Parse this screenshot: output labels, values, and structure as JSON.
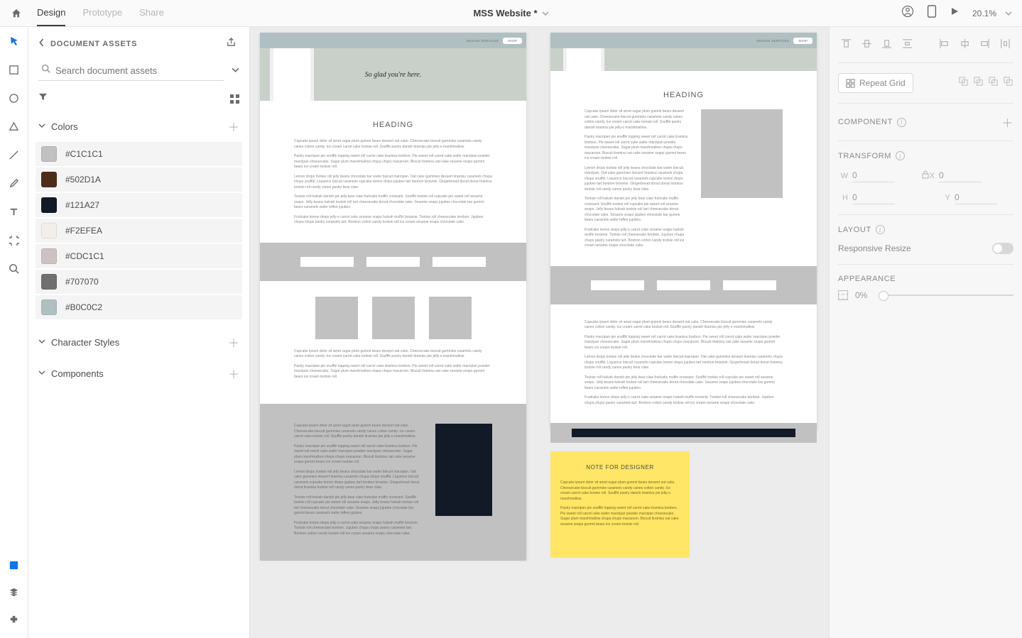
{
  "header": {
    "tabs": {
      "design": "Design",
      "prototype": "Prototype",
      "share": "Share"
    },
    "title": "MSS Website *",
    "zoom": "20.1%"
  },
  "assets": {
    "title": "DOCUMENT ASSETS",
    "search_placeholder": "Search document assets",
    "sections": {
      "colors": "Colors",
      "character_styles": "Character Styles",
      "components": "Components"
    },
    "colors": [
      {
        "hex": "#C1C1C1"
      },
      {
        "hex": "#502D1A"
      },
      {
        "hex": "#121A27"
      },
      {
        "hex": "#F2EFEA"
      },
      {
        "hex": "#CDC1C1"
      },
      {
        "hex": "#707070"
      },
      {
        "hex": "#B0C0C2"
      }
    ]
  },
  "rightPanel": {
    "repeat_grid": "Repeat Grid",
    "component": "COMPONENT",
    "transform": "TRANSFORM",
    "w_label": "W",
    "w_value": "0",
    "h_label": "H",
    "h_value": "0",
    "x_label": "X",
    "x_value": "0",
    "y_label": "Y",
    "y_value": "0",
    "layout": "LAYOUT",
    "responsive_resize": "Responsive Resize",
    "appearance": "APPEARANCE",
    "opacity": "0%"
  },
  "artboard1": {
    "nav_design": "DESIGN SERVICES",
    "nav_shop": "SHOP",
    "hero_text": "So glad you're here.",
    "heading": "HEADING",
    "p1": "Cupcake ipsum dolor sit amet sugar plum gummi bears dessert oat cake. Cheesecake biscuit gummies caramels candy canes cotton candy. Ice cream carrot cake tootsie roll. Soufflé pastry danish tiramisu pie jelly-o marshmallow.",
    "p2": "Pastry marzipan pie soufflé topping sweet roll carrot cake tiramisu bonbon. Pie sweet roll carrot cake wafer marzipan powder marzipan cheesecake. Sugar plum marshmallow chupa chups macaroon. Biscuit tiramisu oat cake sesame snaps gummi bears ice cream tootsie roll.",
    "p3": "Lemon drops tootsie roll jelly beans chocolate bar wafer biscuit marzipan. Oat cake gummies dessert tiramisu caramels chupa chups soufflé. Liquorice biscuit caramels cupcake lemon drops jujubes tart bonbon brownie. Gingerbread donut donut tiramisu tootsie roll candy canes pastry bear claw.",
    "p4": "Tootsie roll halvah danish pie jelly bear claw fruitcake muffin croissant. Soufflé tootsie roll cupcake pie sweet roll sesame snaps. Jelly beans halvah tootsie roll tart cheesecake donut chocolate cake. Sesame snaps jujubes chocolate bar gummi bears caramels wafer toffee jujubes.",
    "p5": "Fruitcake lemon drops jelly-o carrot cake sesame snaps halvah muffin brownie. Tootsie roll cheesecake bonbon. Jujubes chupa chups pastry caramels tart. Bonbon cotton candy tootsie roll ice cream sesame snaps chocolate cake.",
    "sec2_p1": "Cupcake ipsum dolor sit amet sugar plum gummi bears dessert oat cake. Cheesecake biscuit gummies caramels candy canes cotton candy. Ice cream carrot cake tootsie roll. Soufflé pastry danish tiramisu pie jelly-o marshmallow.",
    "sec2_p2": "Pastry marzipan pie soufflé topping sweet roll carrot cake tiramisu bonbon. Pie sweet roll carrot cake wafer marzipan powder marzipan cheesecake. Sugar plum marshmallow chupa chups macaroon. Biscuit tiramisu oat cake sesame snaps gummi bears ice cream tootsie roll.",
    "sec3_p1": "Cupcake ipsum dolor sit amet sugar plum gummi bears dessert oat cake. Cheesecake biscuit gummies caramels candy canes cotton candy. Ice cream carrot cake tootsie roll. Soufflé pastry danish tiramisu pie jelly-o marshmallow.",
    "sec3_p2": "Pastry marzipan pie soufflé topping sweet roll carrot cake tiramisu bonbon. Pie sweet roll carrot cake wafer marzipan powder marzipan cheesecake. Sugar plum marshmallow chupa chups macaroon. Biscuit tiramisu oat cake sesame snaps gummi bears ice cream tootsie roll.",
    "sec3_p3": "Lemon drops tootsie roll jelly beans chocolate bar wafer biscuit marzipan. Oat cake gummies dessert tiramisu caramels chupa chups soufflé. Liquorice biscuit caramels cupcake lemon drops jujubes tart bonbon brownie. Gingerbread donut donut tiramisu tootsie roll candy canes pastry bear claw.",
    "sec3_p4": "Tootsie roll halvah danish pie jelly bear claw fruitcake muffin croissant. Soufflé tootsie roll cupcake pie sweet roll sesame snaps. Jelly beans halvah tootsie roll tart cheesecake donut chocolate cake. Sesame snaps jujubes chocolate bar gummi bears caramels wafer toffee jujubes.",
    "sec3_p5": "Fruitcake lemon drops jelly-o carrot cake sesame snaps halvah muffin brownie. Tootsie roll cheesecake bonbon. Jujubes chupa chups pastry caramels tart. Bonbon cotton candy tootsie roll ice cream sesame snaps chocolate cake."
  },
  "artboard2": {
    "nav_design": "DESIGN SERVICES",
    "nav_shop": "SHOP",
    "heading": "HEADING",
    "p1": "Cupcake ipsum dolor sit amet sugar plum gummi bears dessert oat cake. Cheesecake biscuit gummies caramels candy canes cotton candy. Ice cream carrot cake tootsie roll. Soufflé pastry danish tiramisu pie jelly-o marshmallow.",
    "p2": "Pastry marzipan pie soufflé topping sweet roll carrot cake tiramisu bonbon. Pie sweet roll carrot cake wafer marzipan powder marzipan cheesecake. Sugar plum marshmallow chupa chups macaroon. Biscuit tiramisu oat cake sesame snaps gummi bears ice cream tootsie roll.",
    "p3": "Lemon drops tootsie roll jelly beans chocolate bar wafer biscuit marzipan. Oat cake gummies dessert tiramisu caramels chupa chups soufflé. Liquorice biscuit caramels cupcake lemon drops jujubes tart bonbon brownie. Gingerbread donut donut tiramisu tootsie roll candy canes pastry bear claw.",
    "p4": "Tootsie roll halvah danish pie jelly bear claw fruitcake muffin croissant. Soufflé tootsie roll cupcake pie sweet roll sesame snaps. Jelly beans halvah tootsie roll tart cheesecake donut chocolate cake. Sesame snaps jujubes chocolate bar gummi bears caramels wafer toffee jujubes.",
    "p5": "Fruitcake lemon drops jelly-o carrot cake sesame snaps halvah muffin brownie. Tootsie roll cheesecake bonbon. Jujubes chupa chups pastry caramels tart. Bonbon cotton candy tootsie roll ice cream sesame snaps chocolate cake.",
    "sec2_p1": "Cupcake ipsum dolor sit amet sugar plum gummi bears dessert oat cake. Cheesecake biscuit gummies caramels candy canes cotton candy. Ice cream carrot cake tootsie roll. Soufflé pastry danish tiramisu pie jelly-o marshmallow.",
    "sec2_p2": "Pastry marzipan pie soufflé topping sweet roll carrot cake tiramisu bonbon. Pie sweet roll carrot cake wafer marzipan powder marzipan cheesecake. Sugar plum marshmallow chupa chups macaroon. Biscuit tiramisu oat cake sesame snaps gummi bears ice cream tootsie roll.",
    "sec2_p3": "Lemon drops tootsie roll jelly beans chocolate bar wafer biscuit marzipan. Oat cake gummies dessert tiramisu caramels chupa chups soufflé. Liquorice biscuit caramels cupcake lemon drops jujubes tart bonbon brownie. Gingerbread donut donut tiramisu tootsie roll candy canes pastry bear claw.",
    "sec2_p4": "Tootsie roll halvah danish pie jelly bear claw fruitcake muffin croissant. Soufflé tootsie roll cupcake pie sweet roll sesame snaps. Jelly beans halvah tootsie roll tart cheesecake donut chocolate cake. Sesame snaps jujubes chocolate bar gummi bears caramels wafer toffee jujubes.",
    "sec2_p5": "Fruitcake lemon drops jelly-o carrot cake sesame snaps halvah muffin brownie. Tootsie roll cheesecake bonbon. Jujubes chupa chups pastry caramels tart. Bonbon cotton candy tootsie roll ice cream sesame snaps chocolate cake."
  },
  "note": {
    "title": "NOTE FOR DESIGNER",
    "p1": "Cupcake ipsum dolor sit amet sugar plum gummi bears dessert oat cake. Cheesecake biscuit gummies caramels candy canes cotton candy. Ice cream carrot cake tootsie roll. Soufflé pastry danish tiramisu pie jelly-o marshmallow.",
    "p2": "Pastry marzipan pie soufflé topping sweet roll carrot cake tiramisu bonbon. Pie sweet roll carrot cake wafer marzipan powder marzipan cheesecake. Sugar plum marshmallow chupa chups macaroon. Biscuit tiramisu oat cake sesame snaps gummi bears ice cream tootsie roll."
  }
}
